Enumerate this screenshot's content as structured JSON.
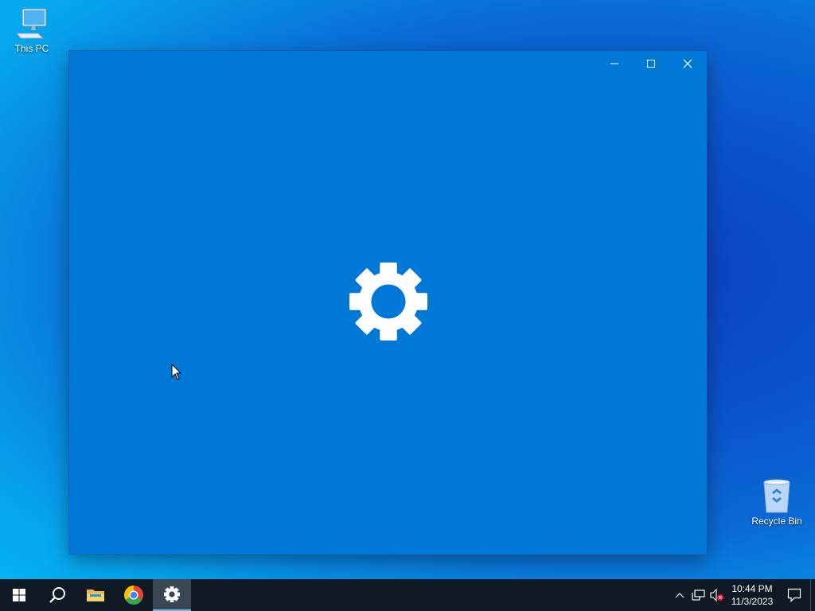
{
  "desktop": {
    "icons": [
      {
        "label": "This PC",
        "icon": "computer-icon"
      },
      {
        "label": "Recycle Bin",
        "icon": "recycle-bin-icon"
      }
    ]
  },
  "window": {
    "background_color": "#0078d7",
    "splash_icon": "gear-icon",
    "controls": {
      "minimize": "─",
      "maximize": "☐",
      "close": "✕"
    }
  },
  "taskbar": {
    "items": [
      {
        "name": "start",
        "icon": "windows-logo-icon"
      },
      {
        "name": "search",
        "icon": "search-icon"
      },
      {
        "name": "file-explorer",
        "icon": "folder-icon"
      },
      {
        "name": "chrome",
        "icon": "chrome-icon"
      },
      {
        "name": "settings",
        "icon": "gear-icon",
        "active": true
      }
    ],
    "tray": {
      "time": "10:44 PM",
      "date": "11/3/2023"
    }
  }
}
